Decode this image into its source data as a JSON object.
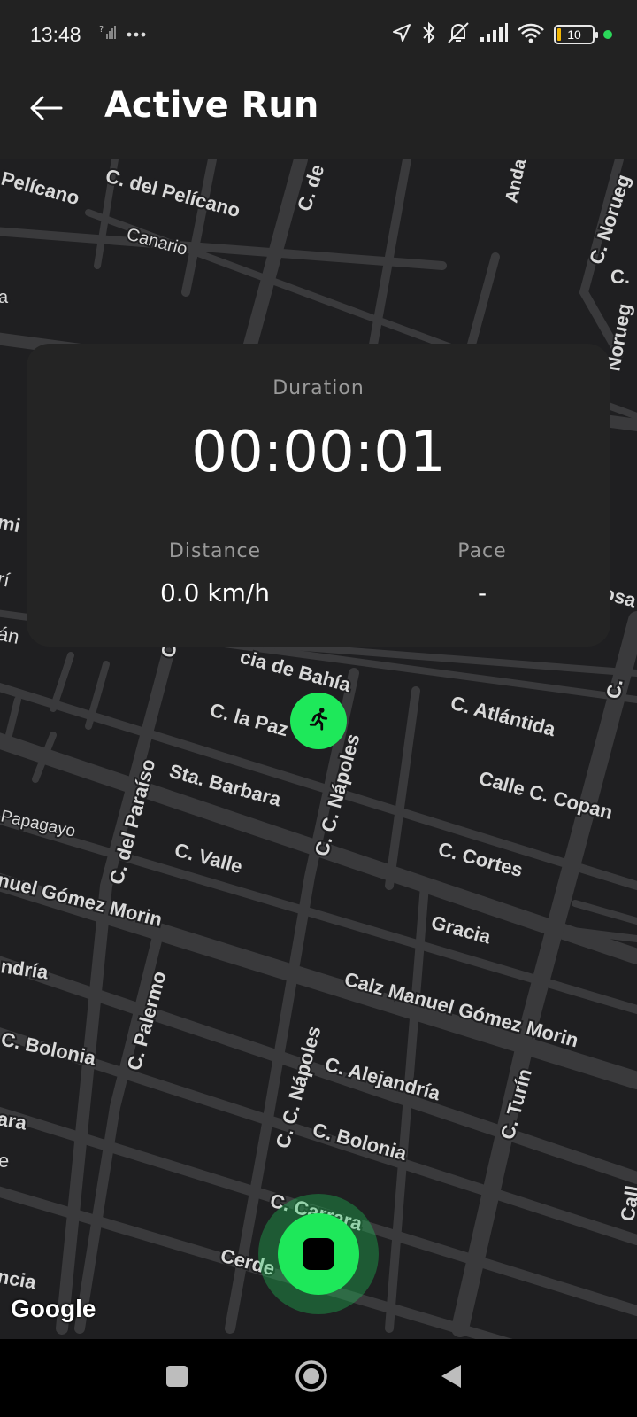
{
  "status_bar": {
    "time": "13:48",
    "battery_level": "10",
    "icons": [
      "signal-question-icon",
      "more-dots-icon",
      "location-arrow-icon",
      "bluetooth-icon",
      "muted-bell-icon",
      "signal-bars-icon",
      "wifi-icon",
      "battery-icon",
      "green-dot-indicator"
    ]
  },
  "app_bar": {
    "title": "Active Run",
    "back_icon": "arrow-left-icon"
  },
  "stats": {
    "duration_label": "Duration",
    "duration_value": "00:00:01",
    "distance_label": "Distance",
    "distance_value": "0.0 km/h",
    "pace_label": "Pace",
    "pace_value": "-"
  },
  "map": {
    "attribution": "Google",
    "streets": [
      "C. del Pelícano",
      "Pelícano",
      "Canario",
      "C. de",
      "Anda",
      "C. Norueg",
      "C.",
      "Norueg",
      "C.",
      "C. Atlántida",
      "C. la Paz",
      "Sta. Barbara",
      "C. C. Nápoles",
      "C. del Paraíso",
      "C. Valle",
      "Calle C. Copan",
      "C. Cortes",
      "Gracia",
      "Papagayo",
      "nuel Gómez Morin",
      "ndría",
      "C. Palermo",
      "C. Bolonia",
      "Calz Manuel Gómez Morin",
      "C. Alejandría",
      "C. C. Nápoles",
      "C. Turín",
      "C. Bolonia",
      "C. Carrara",
      "Cerde",
      "ncia",
      "ara",
      "cia de Bahía",
      "Call",
      "e",
      "mi",
      "rí",
      "án",
      "osa",
      "C",
      "a"
    ]
  },
  "markers": {
    "runner_icon": "running-person-icon"
  },
  "controls": {
    "stop_icon": "stop-square-icon"
  },
  "nav_bar": {
    "recents_icon": "square-recents-icon",
    "home_icon": "circle-home-icon",
    "back_icon": "triangle-back-icon"
  },
  "colors": {
    "accent": "#1ee85a",
    "card_bg": "#242424",
    "map_bg": "#1f1f21",
    "road": "#3a3a3c"
  }
}
